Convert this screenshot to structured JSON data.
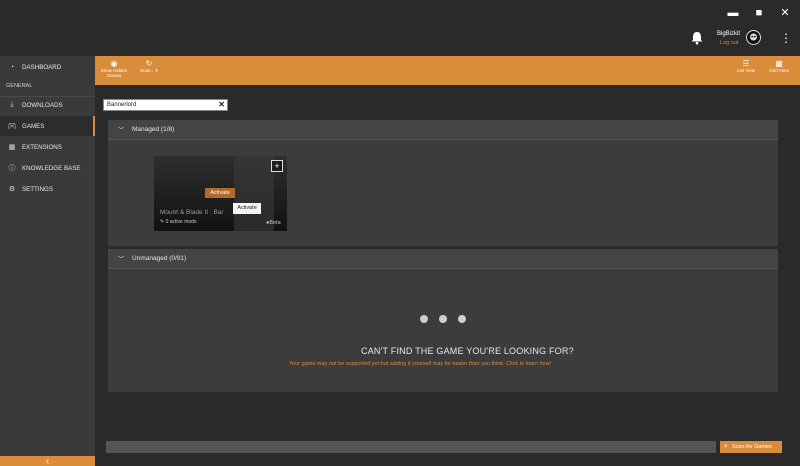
{
  "window": {
    "minimize": "▬",
    "maximize": "■",
    "close": "✕"
  },
  "user": {
    "name": "BigBizkit",
    "logout": "Log out"
  },
  "sidebar": {
    "dashboard": "DASHBOARD",
    "section_header": "GENERAL",
    "items": [
      {
        "label": "DOWNLOADS",
        "icon": "download-icon"
      },
      {
        "label": "GAMES",
        "icon": "gamepad-icon",
        "active": true
      },
      {
        "label": "EXTENSIONS",
        "icon": "grid-icon"
      },
      {
        "label": "KNOWLEDGE BASE",
        "icon": "info-icon"
      },
      {
        "label": "SETTINGS",
        "icon": "gear-icon"
      }
    ]
  },
  "toolbar": {
    "show_hidden_line1": "Show Hidden",
    "show_hidden_line2": "Games",
    "scan_short": "Scan...",
    "list_view": "List View",
    "grid_view": "Grid View"
  },
  "search": {
    "value": "Bannerlord"
  },
  "managed": {
    "header": "Managed (1/8)",
    "game": {
      "title": "Mount & Blade II : Bar",
      "activate": "Activate",
      "tooltip": "Activate",
      "active_mods": "0 active mods",
      "beta": "Beta"
    }
  },
  "unmanaged": {
    "header": "Unmanaged (0/91)",
    "cant_find_title": "CAN'T FIND THE GAME YOU'RE LOOKING FOR?",
    "cant_find_sub": "Your game may not be supported yet but adding it yourself may be easier than you think. Click to learn how!"
  },
  "scan_button": "Scan for Games",
  "colors": {
    "accent": "#d98c3a",
    "background": "#262626",
    "sidebar": "#3a3a3a"
  }
}
